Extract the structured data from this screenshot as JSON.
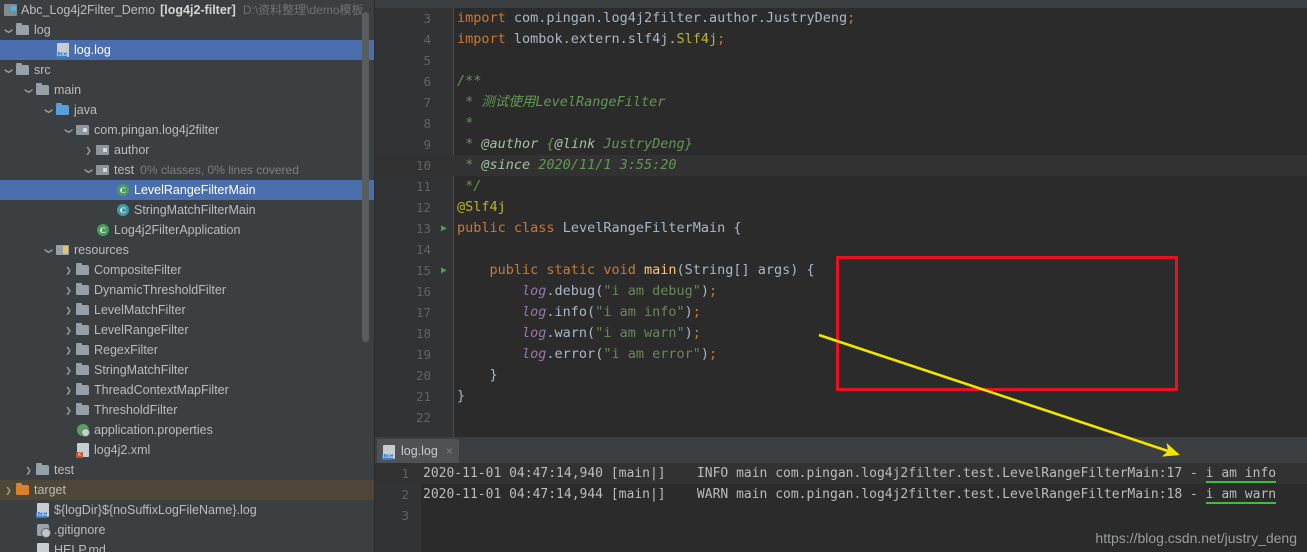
{
  "project_tree": {
    "root": {
      "name": "Abc_Log4j2Filter_Demo",
      "module": "[log4j2-filter]",
      "path": "D:\\资料整理\\demo模板"
    },
    "items": [
      {
        "label": "log",
        "indent": 0,
        "twisty": "down",
        "icon": "folder-icon",
        "state": "normal"
      },
      {
        "label": "log.log",
        "indent": 2,
        "twisty": "none",
        "icon": "log-file-icon",
        "state": "selected-blue"
      },
      {
        "label": "src",
        "indent": 0,
        "twisty": "down",
        "icon": "folder-icon",
        "state": "normal"
      },
      {
        "label": "main",
        "indent": 1,
        "twisty": "down",
        "icon": "folder-icon",
        "state": "normal"
      },
      {
        "label": "java",
        "indent": 2,
        "twisty": "down",
        "icon": "source-folder-icon",
        "state": "normal"
      },
      {
        "label": "com.pingan.log4j2filter",
        "indent": 3,
        "twisty": "down",
        "icon": "package-icon",
        "state": "normal"
      },
      {
        "label": "author",
        "indent": 4,
        "twisty": "right",
        "icon": "package-icon",
        "state": "normal"
      },
      {
        "label": "test",
        "indent": 4,
        "twisty": "down",
        "icon": "package-icon",
        "state": "normal",
        "suffix": "0% classes, 0% lines covered"
      },
      {
        "label": "LevelRangeFilterMain",
        "indent": 5,
        "twisty": "none",
        "icon": "java-class-icon",
        "state": "selected-blue"
      },
      {
        "label": "StringMatchFilterMain",
        "indent": 5,
        "twisty": "none",
        "icon": "java-class-icon-teal",
        "state": "normal"
      },
      {
        "label": "Log4j2FilterApplication",
        "indent": 4,
        "twisty": "none",
        "icon": "spring-boot-class-icon",
        "state": "normal"
      },
      {
        "label": "resources",
        "indent": 2,
        "twisty": "down",
        "icon": "resources-folder-icon",
        "state": "normal"
      },
      {
        "label": "CompositeFilter",
        "indent": 3,
        "twisty": "right",
        "icon": "folder-icon",
        "state": "normal"
      },
      {
        "label": "DynamicThresholdFilter",
        "indent": 3,
        "twisty": "right",
        "icon": "folder-icon",
        "state": "normal"
      },
      {
        "label": "LevelMatchFilter",
        "indent": 3,
        "twisty": "right",
        "icon": "folder-icon",
        "state": "normal"
      },
      {
        "label": "LevelRangeFilter",
        "indent": 3,
        "twisty": "right",
        "icon": "folder-icon",
        "state": "normal"
      },
      {
        "label": "RegexFilter",
        "indent": 3,
        "twisty": "right",
        "icon": "folder-icon",
        "state": "normal"
      },
      {
        "label": "StringMatchFilter",
        "indent": 3,
        "twisty": "right",
        "icon": "folder-icon",
        "state": "normal"
      },
      {
        "label": "ThreadContextMapFilter",
        "indent": 3,
        "twisty": "right",
        "icon": "folder-icon",
        "state": "normal"
      },
      {
        "label": "ThresholdFilter",
        "indent": 3,
        "twisty": "right",
        "icon": "folder-icon",
        "state": "normal"
      },
      {
        "label": "application.properties",
        "indent": 3,
        "twisty": "none",
        "icon": "properties-file-icon",
        "state": "normal"
      },
      {
        "label": "log4j2.xml",
        "indent": 3,
        "twisty": "none",
        "icon": "xml-file-icon",
        "state": "normal"
      },
      {
        "label": "test",
        "indent": 1,
        "twisty": "right",
        "icon": "folder-icon",
        "state": "normal"
      },
      {
        "label": "target",
        "indent": 0,
        "twisty": "right",
        "icon": "folder-icon-orange",
        "state": "selected-brown"
      },
      {
        "label": "${logDir}${noSuffixLogFileName}.log",
        "indent": 1,
        "twisty": "none",
        "icon": "log-file-icon",
        "state": "normal"
      },
      {
        "label": ".gitignore",
        "indent": 1,
        "twisty": "none",
        "icon": "git-file-icon",
        "state": "normal"
      },
      {
        "label": "HELP.md",
        "indent": 1,
        "twisty": "none",
        "icon": "markdown-file-icon",
        "state": "normal"
      }
    ]
  },
  "editor": {
    "lines": [
      {
        "num": "3",
        "run": false,
        "highlight": false,
        "tokens": [
          {
            "t": "import ",
            "c": "kw"
          },
          {
            "t": "com.pingan.log4j2filter.author.",
            "c": "typ"
          },
          {
            "t": "JustryDeng",
            "c": "typ"
          },
          {
            "t": ";",
            "c": "sem"
          }
        ]
      },
      {
        "num": "4",
        "run": false,
        "highlight": false,
        "tokens": [
          {
            "t": "import ",
            "c": "kw"
          },
          {
            "t": "lombok.extern.slf4j.",
            "c": "typ"
          },
          {
            "t": "Slf4j",
            "c": "ann"
          },
          {
            "t": ";",
            "c": "sem"
          }
        ]
      },
      {
        "num": "5",
        "run": false,
        "highlight": false,
        "tokens": [
          {
            "t": "",
            "c": "typ"
          }
        ]
      },
      {
        "num": "6",
        "run": false,
        "highlight": false,
        "tokens": [
          {
            "t": "/**",
            "c": "cmt"
          }
        ]
      },
      {
        "num": "7",
        "run": false,
        "highlight": false,
        "tokens": [
          {
            "t": " * 测试使用LevelRangeFilter",
            "c": "cmt"
          }
        ]
      },
      {
        "num": "8",
        "run": false,
        "highlight": false,
        "tokens": [
          {
            "t": " *",
            "c": "cmt"
          }
        ]
      },
      {
        "num": "9",
        "run": false,
        "highlight": false,
        "tokens": [
          {
            "t": " * ",
            "c": "cmt"
          },
          {
            "t": "@author",
            "c": "cmtTag"
          },
          {
            "t": " {",
            "c": "cmt"
          },
          {
            "t": "@link",
            "c": "cmtTag"
          },
          {
            "t": " JustryDeng}",
            "c": "cmt"
          }
        ]
      },
      {
        "num": "10",
        "run": false,
        "highlight": true,
        "tokens": [
          {
            "t": " * ",
            "c": "cmt"
          },
          {
            "t": "@since",
            "c": "cmtTag"
          },
          {
            "t": " 2020/11/1 3:55:20",
            "c": "cmt"
          }
        ]
      },
      {
        "num": "11",
        "run": false,
        "highlight": false,
        "tokens": [
          {
            "t": " */",
            "c": "cmt"
          }
        ]
      },
      {
        "num": "12",
        "run": false,
        "highlight": false,
        "tokens": [
          {
            "t": "@Slf4j",
            "c": "ann"
          }
        ]
      },
      {
        "num": "13",
        "run": true,
        "highlight": false,
        "tokens": [
          {
            "t": "public ",
            "c": "kw"
          },
          {
            "t": "class ",
            "c": "kw"
          },
          {
            "t": "LevelRangeFilterMain ",
            "c": "typ"
          },
          {
            "t": "{",
            "c": "typ"
          }
        ]
      },
      {
        "num": "14",
        "run": false,
        "highlight": false,
        "tokens": [
          {
            "t": "",
            "c": "typ"
          }
        ]
      },
      {
        "num": "15",
        "run": true,
        "highlight": false,
        "tokens": [
          {
            "t": "    ",
            "c": "typ"
          },
          {
            "t": "public ",
            "c": "kw"
          },
          {
            "t": "static ",
            "c": "kw"
          },
          {
            "t": "void ",
            "c": "kw"
          },
          {
            "t": "main",
            "c": "mth"
          },
          {
            "t": "(String[] args) {",
            "c": "typ"
          }
        ]
      },
      {
        "num": "16",
        "run": false,
        "highlight": false,
        "tokens": [
          {
            "t": "        ",
            "c": "typ"
          },
          {
            "t": "log",
            "c": "fld"
          },
          {
            "t": ".debug(",
            "c": "typ"
          },
          {
            "t": "\"i am debug\"",
            "c": "str"
          },
          {
            "t": ")",
            "c": "typ"
          },
          {
            "t": ";",
            "c": "sem"
          }
        ]
      },
      {
        "num": "17",
        "run": false,
        "highlight": false,
        "tokens": [
          {
            "t": "        ",
            "c": "typ"
          },
          {
            "t": "log",
            "c": "fld"
          },
          {
            "t": ".info(",
            "c": "typ"
          },
          {
            "t": "\"i am info\"",
            "c": "str"
          },
          {
            "t": ")",
            "c": "typ"
          },
          {
            "t": ";",
            "c": "sem"
          }
        ]
      },
      {
        "num": "18",
        "run": false,
        "highlight": false,
        "tokens": [
          {
            "t": "        ",
            "c": "typ"
          },
          {
            "t": "log",
            "c": "fld"
          },
          {
            "t": ".warn(",
            "c": "typ"
          },
          {
            "t": "\"i am warn\"",
            "c": "str"
          },
          {
            "t": ")",
            "c": "typ"
          },
          {
            "t": ";",
            "c": "sem"
          }
        ]
      },
      {
        "num": "19",
        "run": false,
        "highlight": false,
        "tokens": [
          {
            "t": "        ",
            "c": "typ"
          },
          {
            "t": "log",
            "c": "fld"
          },
          {
            "t": ".error(",
            "c": "typ"
          },
          {
            "t": "\"i am error\"",
            "c": "str"
          },
          {
            "t": ")",
            "c": "typ"
          },
          {
            "t": ";",
            "c": "sem"
          }
        ]
      },
      {
        "num": "20",
        "run": false,
        "highlight": false,
        "tokens": [
          {
            "t": "    }",
            "c": "typ"
          }
        ]
      },
      {
        "num": "21",
        "run": false,
        "highlight": false,
        "tokens": [
          {
            "t": "}",
            "c": "typ"
          }
        ]
      },
      {
        "num": "22",
        "run": false,
        "highlight": false,
        "tokens": [
          {
            "t": "",
            "c": "typ"
          }
        ]
      }
    ],
    "run_marker_glyph": "▶",
    "highlight_box_color": "#e81123",
    "arrow_color": "#f2e600"
  },
  "console": {
    "tab": {
      "label": "log.log",
      "close_glyph": "×",
      "icon": "log-file-icon"
    },
    "lines": [
      {
        "num": "1",
        "highlight": true,
        "text": "2020-11-01 04:47:14,940 [main|]    INFO main com.pingan.log4j2filter.test.LevelRangeFilterMain:17 - ",
        "marked": "i am info"
      },
      {
        "num": "2",
        "highlight": false,
        "text": "2020-11-01 04:47:14,944 [main|]    WARN main com.pingan.log4j2filter.test.LevelRangeFilterMain:18 - ",
        "marked": "i am warn"
      },
      {
        "num": "3",
        "highlight": false,
        "text": "",
        "marked": ""
      }
    ]
  },
  "watermark": "https://blog.csdn.net/justry_deng"
}
